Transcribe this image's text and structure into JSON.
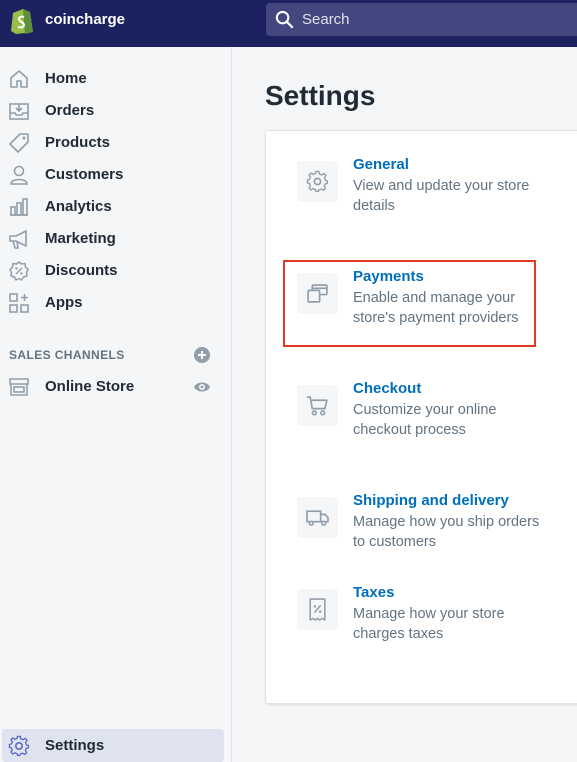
{
  "topbar": {
    "store_name": "coincharge",
    "search_placeholder": "Search"
  },
  "sidebar": {
    "items": [
      {
        "label": "Home",
        "icon": "home-icon"
      },
      {
        "label": "Orders",
        "icon": "orders-icon"
      },
      {
        "label": "Products",
        "icon": "tag-icon"
      },
      {
        "label": "Customers",
        "icon": "person-icon"
      },
      {
        "label": "Analytics",
        "icon": "bar-chart-icon"
      },
      {
        "label": "Marketing",
        "icon": "megaphone-icon"
      },
      {
        "label": "Discounts",
        "icon": "discount-icon"
      },
      {
        "label": "Apps",
        "icon": "apps-icon"
      }
    ],
    "sales_channels_label": "SALES CHANNELS",
    "channels": [
      {
        "label": "Online Store",
        "icon": "store-icon"
      }
    ],
    "settings_label": "Settings"
  },
  "main": {
    "title": "Settings",
    "settings": [
      {
        "title": "General",
        "description": "View and update your store details",
        "icon": "gear-icon"
      },
      {
        "title": "Payments",
        "description": "Enable and manage your store's payment providers",
        "icon": "payments-icon"
      },
      {
        "title": "Checkout",
        "description": "Customize your online checkout process",
        "icon": "cart-icon"
      },
      {
        "title": "Shipping and delivery",
        "description": "Manage how you ship orders to customers",
        "icon": "truck-icon"
      },
      {
        "title": "Taxes",
        "description": "Manage how your store charges taxes",
        "icon": "receipt-icon"
      }
    ]
  },
  "colors": {
    "topbar": "#1c2260",
    "link": "#006fbb",
    "highlight": "#e03a24"
  }
}
